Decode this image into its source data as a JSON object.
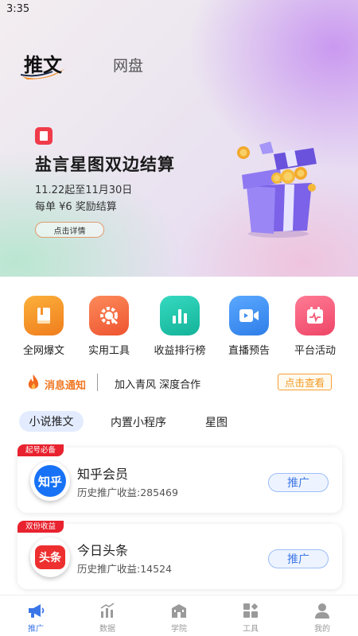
{
  "status_bar": {
    "time": "3:35"
  },
  "top_tabs": {
    "active": "推文",
    "inactive": "网盘"
  },
  "banner": {
    "title": "盐言星图双边结算",
    "line1": "11.22起至11月30日",
    "line2": "每单 ¥6 奖励结算",
    "button": "点击详情"
  },
  "quick_actions": [
    {
      "label": "全网爆文",
      "icon": "book-icon",
      "color": "#f5922a"
    },
    {
      "label": "实用工具",
      "icon": "gear-tool-icon",
      "color": "#f06a3c"
    },
    {
      "label": "收益排行榜",
      "icon": "bar-chart-icon",
      "color": "#1fc3a8"
    },
    {
      "label": "直播预告",
      "icon": "video-camera-icon",
      "color": "#3b8ff0"
    },
    {
      "label": "平台活动",
      "icon": "calendar-icon",
      "color": "#f25a78"
    }
  ],
  "notice": {
    "title": "消息通知",
    "text": "加入青风 深度合作",
    "button": "点击查看"
  },
  "content_tabs": [
    "小说推文",
    "内置小程序",
    "星图"
  ],
  "cards": [
    {
      "tag": "起号必备",
      "logo_text": "知乎",
      "title": "知乎会员",
      "earn_label": "历史推广收益:",
      "earn_value": "285469",
      "button": "推广",
      "logo_color": "#1772f6"
    },
    {
      "tag": "双份收益",
      "logo_text": "头条",
      "title": "今日头条",
      "earn_label": "历史推广收益:",
      "earn_value": "14524",
      "button": "推广",
      "logo_color": "#ee2f2f"
    }
  ],
  "bottom_nav": [
    {
      "label": "推广",
      "icon": "megaphone-icon",
      "active": true
    },
    {
      "label": "数据",
      "icon": "stats-icon",
      "active": false
    },
    {
      "label": "学院",
      "icon": "school-icon",
      "active": false
    },
    {
      "label": "工具",
      "icon": "tools-grid-icon",
      "active": false
    },
    {
      "label": "我的",
      "icon": "user-icon",
      "active": false
    }
  ]
}
